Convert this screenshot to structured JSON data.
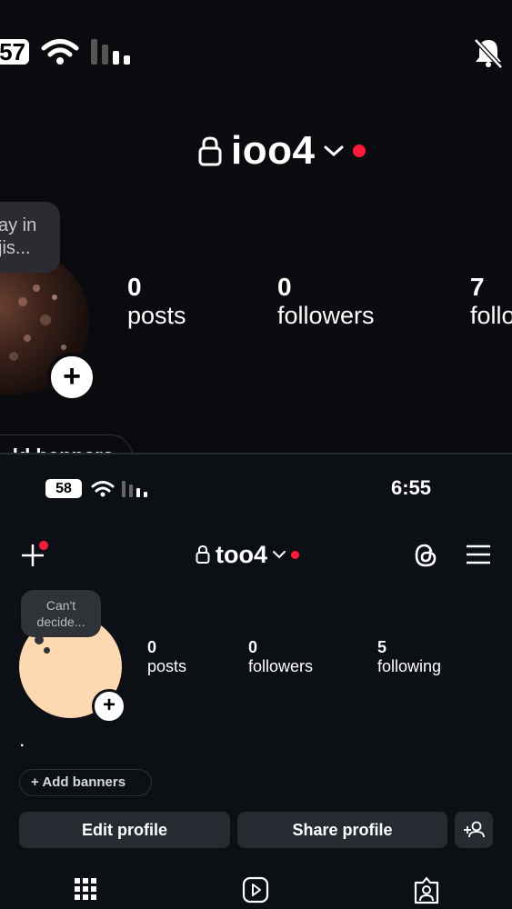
{
  "top_screen": {
    "battery": "57",
    "username": "ioo4",
    "note_bubble": [
      "ay in",
      "jis..."
    ],
    "stats": [
      {
        "value": "0",
        "label": "posts"
      },
      {
        "value": "0",
        "label": "followers"
      },
      {
        "value": "7",
        "label": "follo"
      }
    ],
    "banner_button": "ld banners"
  },
  "bottom_screen": {
    "battery": "58",
    "time": "6:55",
    "username": "too4",
    "note_bubble": "Can't decide...",
    "stats": [
      {
        "value": "0",
        "label": "posts"
      },
      {
        "value": "0",
        "label": "followers"
      },
      {
        "value": "5",
        "label": "following"
      }
    ],
    "bio": ".",
    "banner_button": "+ Add banners",
    "edit_profile": "Edit profile",
    "share_profile": "Share profile"
  },
  "colors": {
    "background": "#0c0f14",
    "button_bg": "#262a31",
    "notification_dot": "#ff1a3c",
    "avatar_fill": "#fed8b1"
  },
  "icons": [
    "wifi-icon",
    "signal-icon",
    "mute-bell-icon",
    "lock-icon",
    "chevron-down-icon",
    "plus-icon",
    "threads-icon",
    "hamburger-menu-icon",
    "add-person-icon",
    "grid-icon",
    "reels-icon",
    "tagged-icon"
  ]
}
